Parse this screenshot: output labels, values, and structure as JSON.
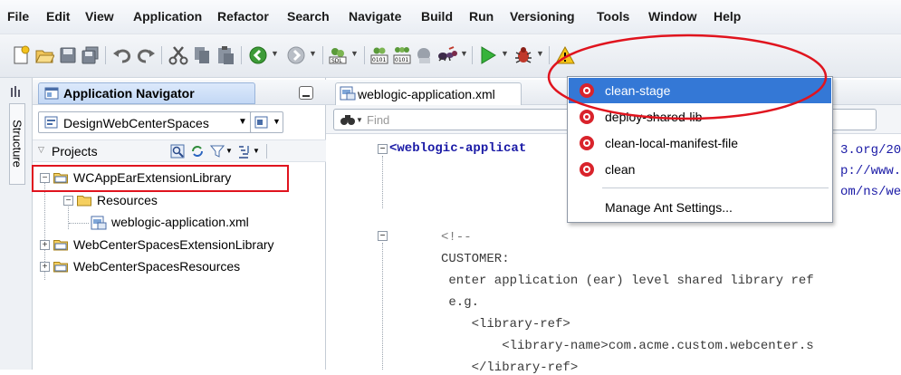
{
  "menu": {
    "items": [
      "File",
      "Edit",
      "View",
      "Application",
      "Refactor",
      "Search",
      "Navigate",
      "Build",
      "Run",
      "Versioning",
      "Tools",
      "Window",
      "Help"
    ]
  },
  "toolbar": {
    "icons": [
      "new-icon",
      "open-icon",
      "save-icon",
      "save-all-icon",
      "undo-icon",
      "redo-icon",
      "cut-icon",
      "copy-icon",
      "paste-icon",
      "back-icon",
      "forward-icon",
      "make-icon",
      "compile-icon",
      "rebuild-icon",
      "ant-icon",
      "run-icon",
      "debug-icon",
      "warning-icon"
    ]
  },
  "structure": {
    "label": "Structure"
  },
  "navigator": {
    "title": "Application Navigator",
    "application_combo": "DesignWebCenterSpaces",
    "projects_label": "Projects",
    "tree": [
      {
        "label": "WCAppEarExtensionLibrary",
        "expanded": true,
        "highlighted": true
      },
      {
        "label": "Resources",
        "expanded": true
      },
      {
        "label": "weblogic-application.xml"
      },
      {
        "label": "WebCenterSpacesExtensionLibrary",
        "expanded": false
      },
      {
        "label": "WebCenterSpacesResources",
        "expanded": false
      }
    ]
  },
  "editor": {
    "tab_label": "weblogic-application.xml",
    "find_placeholder": "Find",
    "code_lines": [
      "<weblogic-applicat",
      "<!--",
      "CUSTOMER:",
      " enter application (ear) level shared library ref",
      " e.g.",
      "    <library-ref>",
      "        <library-name>com.acme.custom.webcenter.s",
      "    </library-ref>"
    ],
    "right_fragments": [
      "3.org/20",
      "p://www.",
      "om/ns/we"
    ]
  },
  "ant_popup": {
    "items": [
      {
        "label": "clean-stage",
        "selected": true
      },
      {
        "label": "deploy-shared-lib",
        "selected": false
      },
      {
        "label": "clean-local-manifest-file",
        "selected": false
      },
      {
        "label": "clean",
        "selected": false
      }
    ],
    "manage_label": "Manage Ant Settings..."
  },
  "colors": {
    "selection": "#3478d6",
    "annotation_red": "#e0141e",
    "stop_red": "#d9232b",
    "code_tag_blue": "#1a1aa6"
  }
}
